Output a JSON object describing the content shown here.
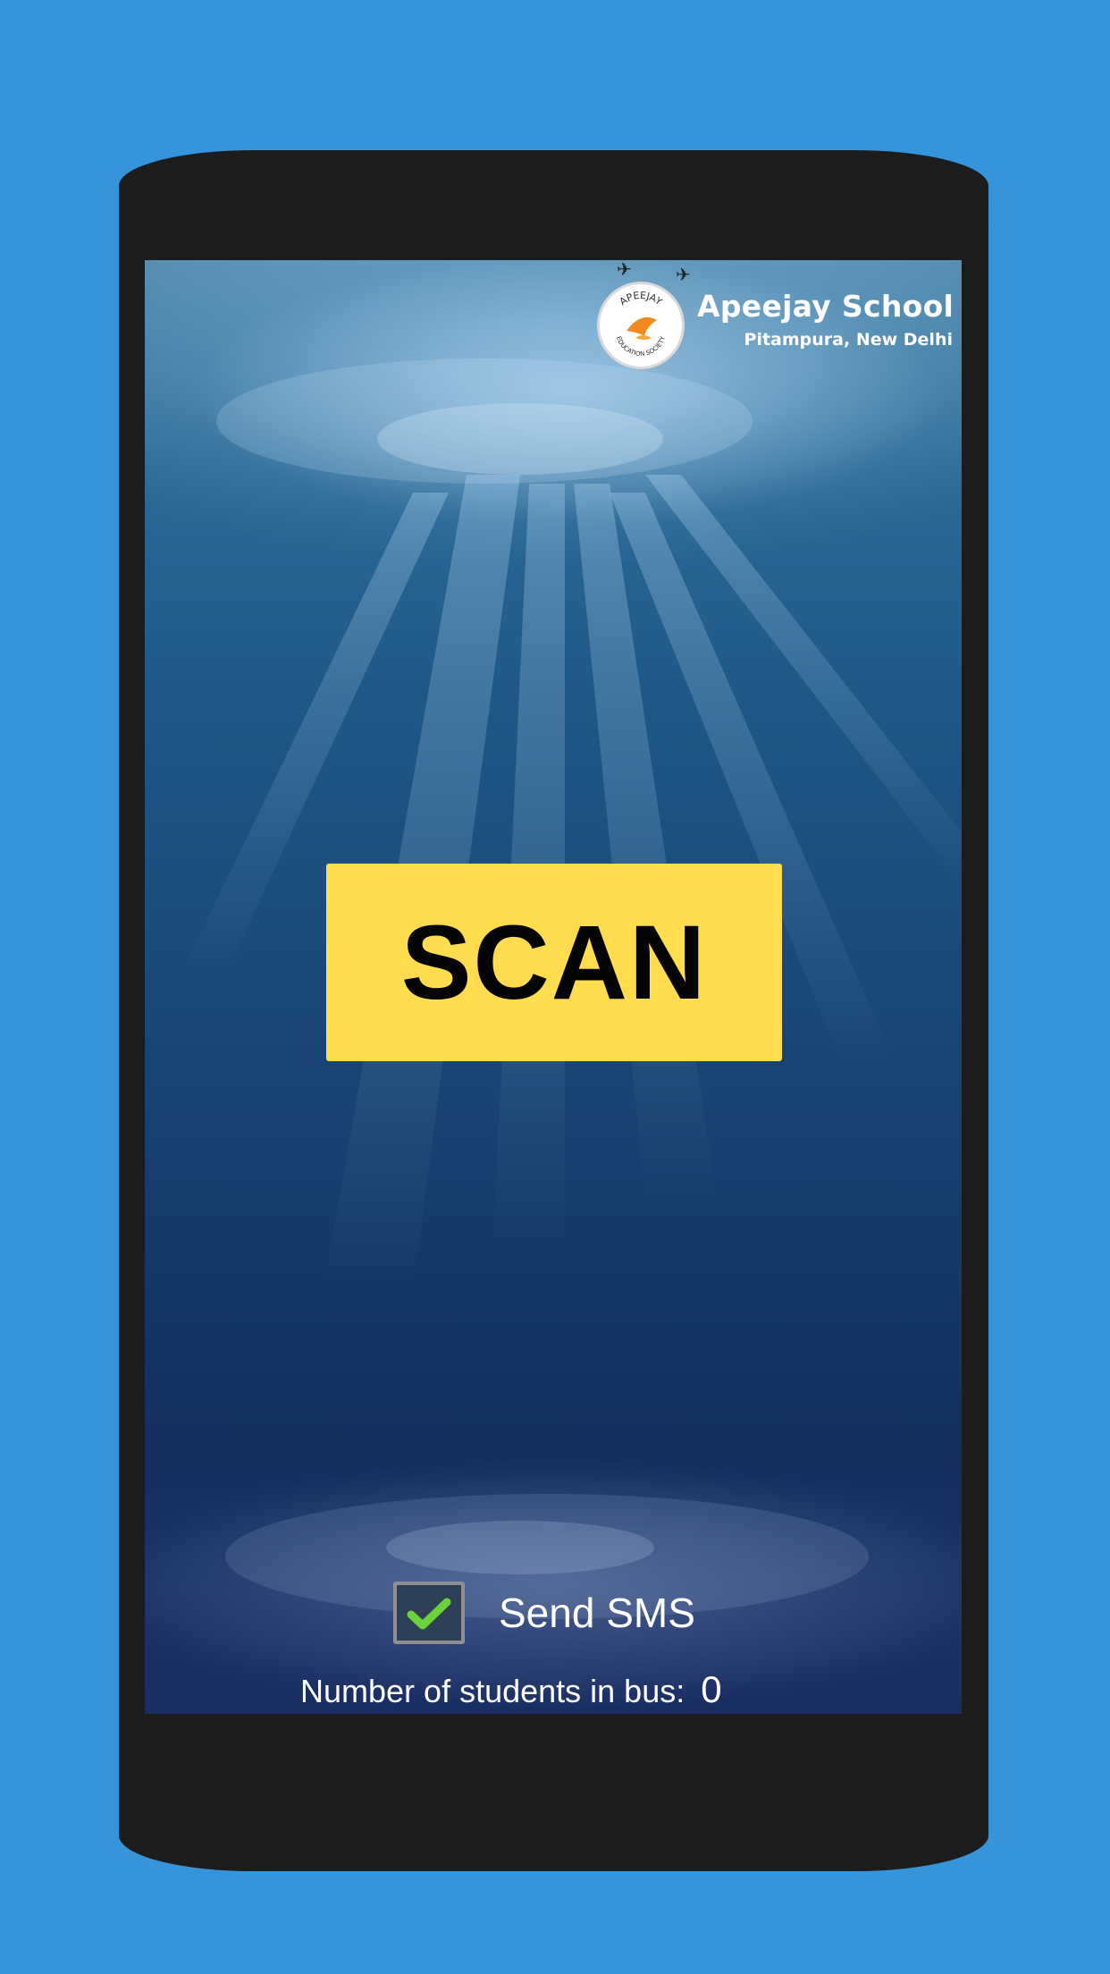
{
  "header": {
    "school_name": "Apeejay School",
    "school_location": "Pitampura, New Delhi",
    "emblem_top_text": "APEEJAY",
    "emblem_bottom_text": "EDUCATION SOCIETY"
  },
  "main": {
    "scan_label": "SCAN"
  },
  "footer": {
    "send_sms_label": "Send SMS",
    "send_sms_checked": true,
    "students_label": "Number of students in bus:",
    "students_count": "0"
  },
  "colors": {
    "background": "#3595dc",
    "phone_frame": "#1c1c1c",
    "scan_button": "#ffdd4f",
    "checkmark": "#6cd23a"
  },
  "icons": {
    "emblem": "apeejay-logo-icon",
    "birds": "bird-icon",
    "check": "check-icon"
  }
}
